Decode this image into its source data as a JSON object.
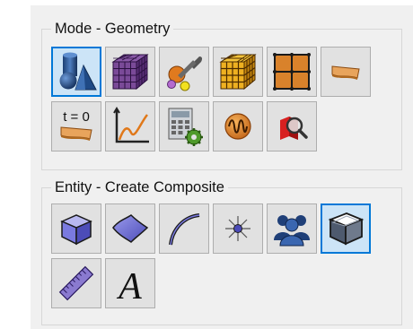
{
  "geometry_group": {
    "title": "Mode - Geometry",
    "buttons": [
      {
        "name": "geometry-mode-button",
        "icon": "shapes-icon",
        "selected": true
      },
      {
        "name": "mesh-mode-button",
        "icon": "mesh-cube-icon",
        "selected": false
      },
      {
        "name": "properties-mode-button",
        "icon": "wrench-tool-icon",
        "selected": false
      },
      {
        "name": "element-mode-button",
        "icon": "grid-cube-icon",
        "selected": false
      },
      {
        "name": "boundary-mode-button",
        "icon": "grid-plane-icon",
        "selected": false
      },
      {
        "name": "section-mode-button",
        "icon": "beam-section-icon",
        "selected": false
      },
      {
        "name": "initial-condition-button",
        "icon": "time-zero-icon",
        "selected": false,
        "label": "t = 0"
      },
      {
        "name": "graph-mode-button",
        "icon": "graph-icon",
        "selected": false
      },
      {
        "name": "calculator-settings-button",
        "icon": "calculator-gear-icon",
        "selected": false
      },
      {
        "name": "signal-mode-button",
        "icon": "wave-icon",
        "selected": false
      },
      {
        "name": "inspect-mode-button",
        "icon": "magnifier-icon",
        "selected": false
      }
    ]
  },
  "entity_group": {
    "title": "Entity - Create Composite",
    "buttons": [
      {
        "name": "volume-entity-button",
        "icon": "volume-icon",
        "selected": false
      },
      {
        "name": "surface-entity-button",
        "icon": "surface-icon",
        "selected": false
      },
      {
        "name": "curve-entity-button",
        "icon": "curve-icon",
        "selected": false
      },
      {
        "name": "vertex-entity-button",
        "icon": "vertex-icon",
        "selected": false
      },
      {
        "name": "group-entity-button",
        "icon": "group-people-icon",
        "selected": false
      },
      {
        "name": "composite-entity-button",
        "icon": "composite-box-icon",
        "selected": true
      },
      {
        "name": "measure-button",
        "icon": "ruler-icon",
        "selected": false
      },
      {
        "name": "annotation-button",
        "icon": "text-a-icon",
        "selected": false,
        "label": "A"
      }
    ]
  },
  "colors": {
    "selection_border": "#0078d7",
    "selection_fill": "#cce4f7",
    "button_face": "#e1e1e1"
  }
}
